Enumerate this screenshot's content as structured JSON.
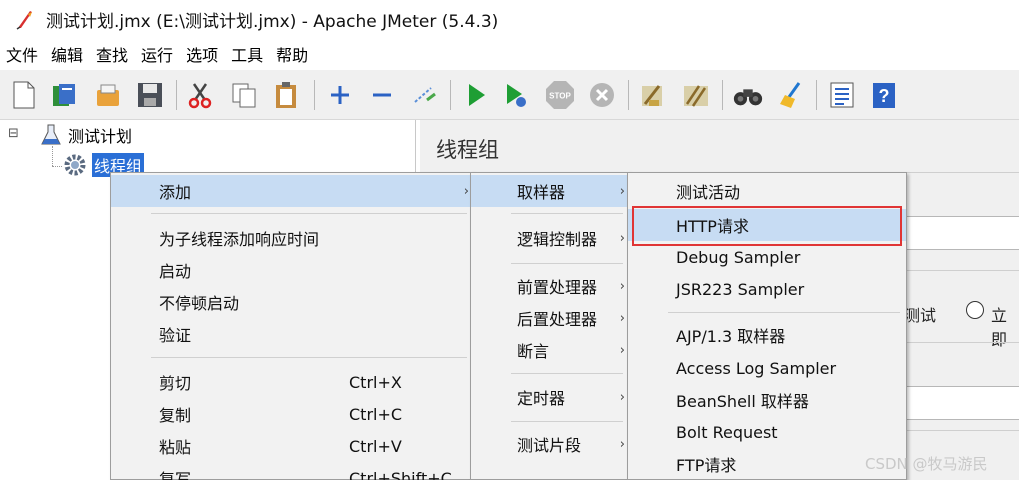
{
  "window": {
    "title": "测试计划.jmx (E:\\测试计划.jmx) - Apache JMeter (5.4.3)"
  },
  "menubar": {
    "items": [
      "文件",
      "编辑",
      "查找",
      "运行",
      "选项",
      "工具",
      "帮助"
    ]
  },
  "toolbar": {
    "buttons": [
      "new-icon",
      "templates-icon",
      "open-icon",
      "save-icon",
      "cut-icon",
      "copy-icon",
      "paste-icon",
      "expand-icon",
      "collapse-icon",
      "toggle-icon",
      "start-icon",
      "start-no-pauses-icon",
      "stop-icon",
      "shutdown-icon",
      "clear-icon",
      "clear-all-icon",
      "search-icon",
      "reset-search-icon",
      "function-helper-icon",
      "help-icon"
    ],
    "stop_text": "STOP"
  },
  "tree": {
    "root": "测试计划",
    "child": "线程组",
    "expander": "⊟"
  },
  "right_panel": {
    "header": "线程组",
    "radio_text_1": "止测试",
    "radio_text_2": "立即"
  },
  "context_menu": {
    "add": "添加",
    "items": [
      {
        "label": "为子线程添加响应时间",
        "shortcut": ""
      },
      {
        "label": "启动",
        "shortcut": ""
      },
      {
        "label": "不停顿启动",
        "shortcut": ""
      },
      {
        "label": "验证",
        "shortcut": ""
      },
      {
        "label": "剪切",
        "shortcut": "Ctrl+X"
      },
      {
        "label": "复制",
        "shortcut": "Ctrl+C"
      },
      {
        "label": "粘贴",
        "shortcut": "Ctrl+V"
      },
      {
        "label": "复写",
        "shortcut": "Ctrl+Shift+C"
      }
    ]
  },
  "add_submenu": {
    "items": [
      "取样器",
      "逻辑控制器",
      "前置处理器",
      "后置处理器",
      "断言",
      "定时器",
      "测试片段"
    ]
  },
  "sampler_submenu": {
    "items": [
      "测试活动",
      "HTTP请求",
      "Debug Sampler",
      "JSR223 Sampler",
      "AJP/1.3 取样器",
      "Access Log Sampler",
      "BeanShell 取样器",
      "Bolt Request",
      "FTP请求"
    ],
    "highlighted": "HTTP请求"
  },
  "watermark": "CSDN @牧马游民",
  "colors": {
    "highlight": "#c7dcf3",
    "selection": "#2a6fd6",
    "annotation": "#e03535"
  }
}
